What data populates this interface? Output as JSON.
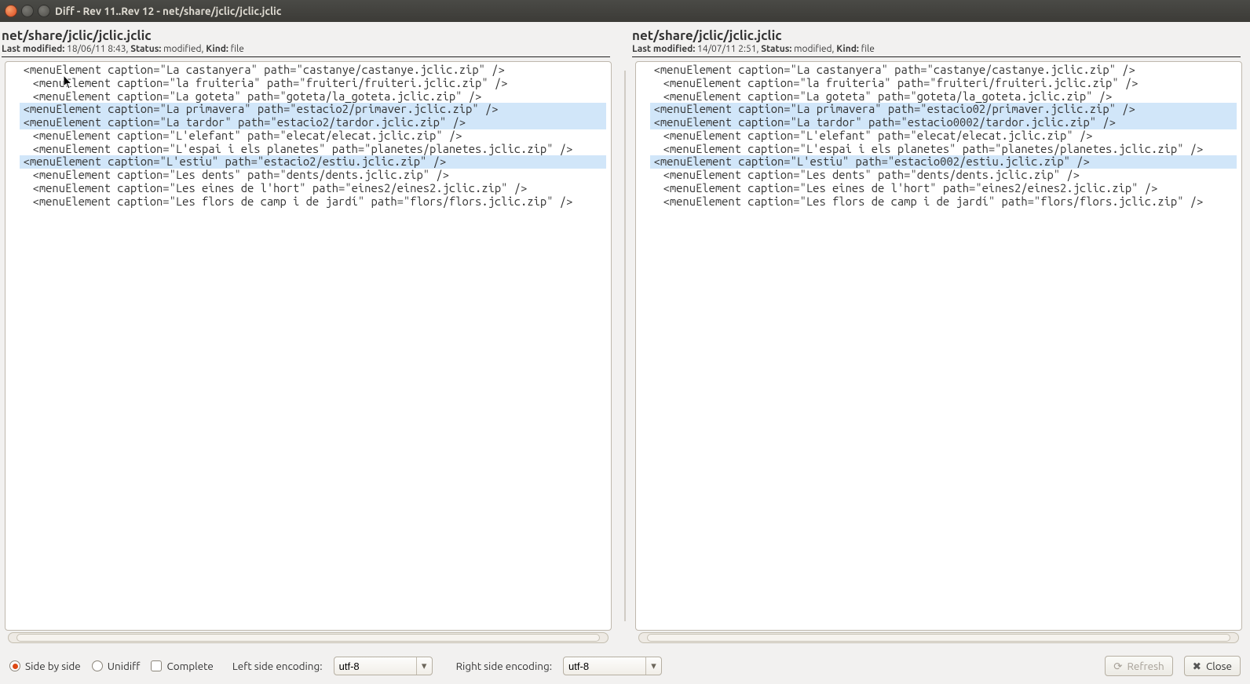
{
  "window": {
    "title": "Diff - Rev 11..Rev 12 - net/share/jclic/jclic.jclic"
  },
  "left": {
    "path": "net/share/jclic/jclic.jclic",
    "modified": "18/06/11 8:43",
    "status": "modified",
    "kind": "file",
    "lines": [
      {
        "t": "  <menuElement caption=\"La castanyera\" path=\"castanye/castanye.jclic.zip\" />",
        "d": false
      },
      {
        "t": "  <menuElement caption=\"la fruiteria\" path=\"fruiteri/fruiteri.jclic.zip\" />",
        "d": false
      },
      {
        "t": "  <menuElement caption=\"La goteta\" path=\"goteta/la_goteta.jclic.zip\" />",
        "d": false
      },
      {
        "t": "  <menuElement caption=\"La primavera\" path=\"estacio2/primaver.jclic.zip\" />",
        "d": true
      },
      {
        "t": "  <menuElement caption=\"La tardor\" path=\"estacio2/tardor.jclic.zip\" />",
        "d": true
      },
      {
        "t": "  <menuElement caption=\"L'elefant\" path=\"elecat/elecat.jclic.zip\" />",
        "d": false
      },
      {
        "t": "  <menuElement caption=\"L'espai i els planetes\" path=\"planetes/planetes.jclic.zip\" />",
        "d": false
      },
      {
        "t": "  <menuElement caption=\"L'estiu\" path=\"estacio2/estiu.jclic.zip\" />",
        "d": true
      },
      {
        "t": "  <menuElement caption=\"Les dents\" path=\"dents/dents.jclic.zip\" />",
        "d": false
      },
      {
        "t": "  <menuElement caption=\"Les eines de l'hort\" path=\"eines2/eines2.jclic.zip\" />",
        "d": false
      },
      {
        "t": "  <menuElement caption=\"Les flors de camp i de jardí\" path=\"flors/flors.jclic.zip\" />",
        "d": false
      }
    ]
  },
  "right": {
    "path": "net/share/jclic/jclic.jclic",
    "modified": "14/07/11 2:51",
    "status": "modified",
    "kind": "file",
    "lines": [
      {
        "t": "  <menuElement caption=\"La castanyera\" path=\"castanye/castanye.jclic.zip\" />",
        "d": false
      },
      {
        "t": "  <menuElement caption=\"la fruiteria\" path=\"fruiteri/fruiteri.jclic.zip\" />",
        "d": false
      },
      {
        "t": "  <menuElement caption=\"La goteta\" path=\"goteta/la_goteta.jclic.zip\" />",
        "d": false
      },
      {
        "t": "  <menuElement caption=\"La primavera\" path=\"estacio02/primaver.jclic.zip\" />",
        "d": true
      },
      {
        "t": "  <menuElement caption=\"La tardor\" path=\"estacio0002/tardor.jclic.zip\" />",
        "d": true
      },
      {
        "t": "  <menuElement caption=\"L'elefant\" path=\"elecat/elecat.jclic.zip\" />",
        "d": false
      },
      {
        "t": "  <menuElement caption=\"L'espai i els planetes\" path=\"planetes/planetes.jclic.zip\" />",
        "d": false
      },
      {
        "t": "  <menuElement caption=\"L'estiu\" path=\"estacio002/estiu.jclic.zip\" />",
        "d": true
      },
      {
        "t": "  <menuElement caption=\"Les dents\" path=\"dents/dents.jclic.zip\" />",
        "d": false
      },
      {
        "t": "  <menuElement caption=\"Les eines de l'hort\" path=\"eines2/eines2.jclic.zip\" />",
        "d": false
      },
      {
        "t": "  <menuElement caption=\"Les flors de camp i de jardí\" path=\"flors/flors.jclic.zip\" />",
        "d": false
      }
    ]
  },
  "labels": {
    "last_modified": "Last modified:",
    "status": "Status:",
    "kind": "Kind:"
  },
  "bottom": {
    "side_by_side": "Side by side",
    "unidiff": "Unidiff",
    "complete": "Complete",
    "left_enc_label": "Left side encoding:",
    "right_enc_label": "Right side encoding:",
    "left_enc_value": "utf-8",
    "right_enc_value": "utf-8",
    "refresh": "Refresh",
    "close": "Close"
  }
}
